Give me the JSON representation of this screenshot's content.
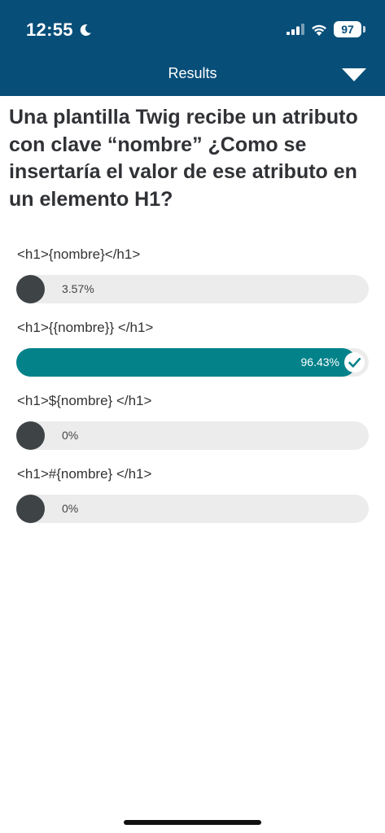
{
  "status_bar": {
    "time": "12:55",
    "battery": "97"
  },
  "header": {
    "title": "Results"
  },
  "question": "Una plantilla Twig recibe un atributo con clave “nombre” ¿Como se insertaría el valor de ese atributo en un elemento H1?",
  "options": [
    {
      "label": "<h1>{nombre}</h1>",
      "percent_label": "3.57%",
      "percent": 3.57,
      "correct": false
    },
    {
      "label": "<h1>{{nombre}} </h1>",
      "percent_label": "96.43%",
      "percent": 96.43,
      "correct": true
    },
    {
      "label": "<h1>${nombre} </h1>",
      "percent_label": "0%",
      "percent": 0,
      "correct": false
    },
    {
      "label": "<h1>#{nombre} </h1>",
      "percent_label": "0%",
      "percent": 0,
      "correct": false
    }
  ],
  "colors": {
    "header": "#074e79",
    "bar_fill": "#3e4446",
    "bar_correct": "#03828a",
    "bar_track": "#ececec"
  },
  "icons": [
    "moon-icon",
    "signal-icon",
    "wifi-icon",
    "dropdown-icon",
    "check-icon"
  ]
}
